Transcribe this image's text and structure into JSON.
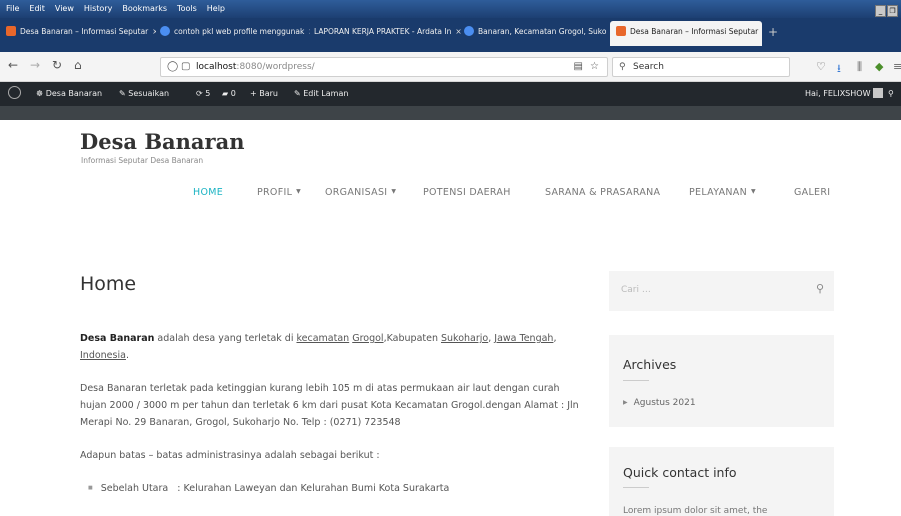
{
  "browser": {
    "menu": [
      "File",
      "Edit",
      "View",
      "History",
      "Bookmarks",
      "Tools",
      "Help"
    ],
    "tabs": [
      {
        "label": "Desa Banaran – Informasi Seputar",
        "icon": "wordpress-icon"
      },
      {
        "label": "contoh pkl web profile menggunak",
        "icon": "chrome-icon"
      },
      {
        "label": "LAPORAN KERJA PRAKTEK - Ardata In",
        "icon": ""
      },
      {
        "label": "Banaran, Kecamatan Grogol, Suko",
        "icon": "chrome-icon"
      },
      {
        "label": "Desa Banaran – Informasi Seputar",
        "icon": "wordpress-icon"
      }
    ],
    "close_glyph": "×",
    "new_tab_glyph": "+",
    "url_host": "localhost",
    "url_path": ":8080/wordpress/",
    "search_placeholder": "Search"
  },
  "adminbar": {
    "site": "Desa Banaran",
    "customize": "Sesuaikan",
    "updates": "5",
    "comments": "0",
    "new": "Baru",
    "edit": "Edit Laman",
    "greeting": "Hai, FELIXSHOW"
  },
  "site": {
    "title": "Desa Banaran",
    "description": "Informasi Seputar Desa Banaran"
  },
  "nav": [
    {
      "label": "HOME",
      "active": true,
      "dropdown": false
    },
    {
      "label": "PROFIL",
      "active": false,
      "dropdown": true
    },
    {
      "label": "ORGANISASI",
      "active": false,
      "dropdown": true
    },
    {
      "label": "POTENSI DAERAH",
      "active": false,
      "dropdown": false
    },
    {
      "label": "SARANA & PRASARANA",
      "active": false,
      "dropdown": false
    },
    {
      "label": "PELAYANAN",
      "active": false,
      "dropdown": true
    },
    {
      "label": "GALERI",
      "active": false,
      "dropdown": false
    }
  ],
  "page": {
    "title": "Home",
    "p1": {
      "bold": "Desa Banaran",
      "t1": " adalah desa yang terletak di ",
      "l1": "kecamatan",
      "t2": " ",
      "l2": "Grogol",
      "t3": ",Kabupaten ",
      "l3": "Sukoharjo",
      "t4": ", ",
      "l4": "Jawa Tengah",
      "t5": ", ",
      "l5": "Indonesia",
      "t6": "."
    },
    "p2": "Desa Banaran terletak pada ketinggian kurang lebih 105 m di atas permukaan air laut dengan curah hujan 2000 / 3000 m per tahun dan terletak 6 km dari pusat Kota Kecamatan Grogol.dengan Alamat : Jln Merapi No. 29 Banaran, Grogol, Sukoharjo No. Telp : (0271) 723548",
    "p3": "Adapun batas – batas administrasinya adalah sebagai berikut :",
    "list": [
      "Sebelah Utara   : Kelurahan Laweyan dan Kelurahan Bumi Kota Surakarta"
    ]
  },
  "sidebar": {
    "search_placeholder": "Cari …",
    "archives_title": "Archives",
    "archives": [
      "Agustus 2021"
    ],
    "quick_title": "Quick contact info",
    "quick_text": "Lorem ipsum dolor sit amet, the"
  }
}
